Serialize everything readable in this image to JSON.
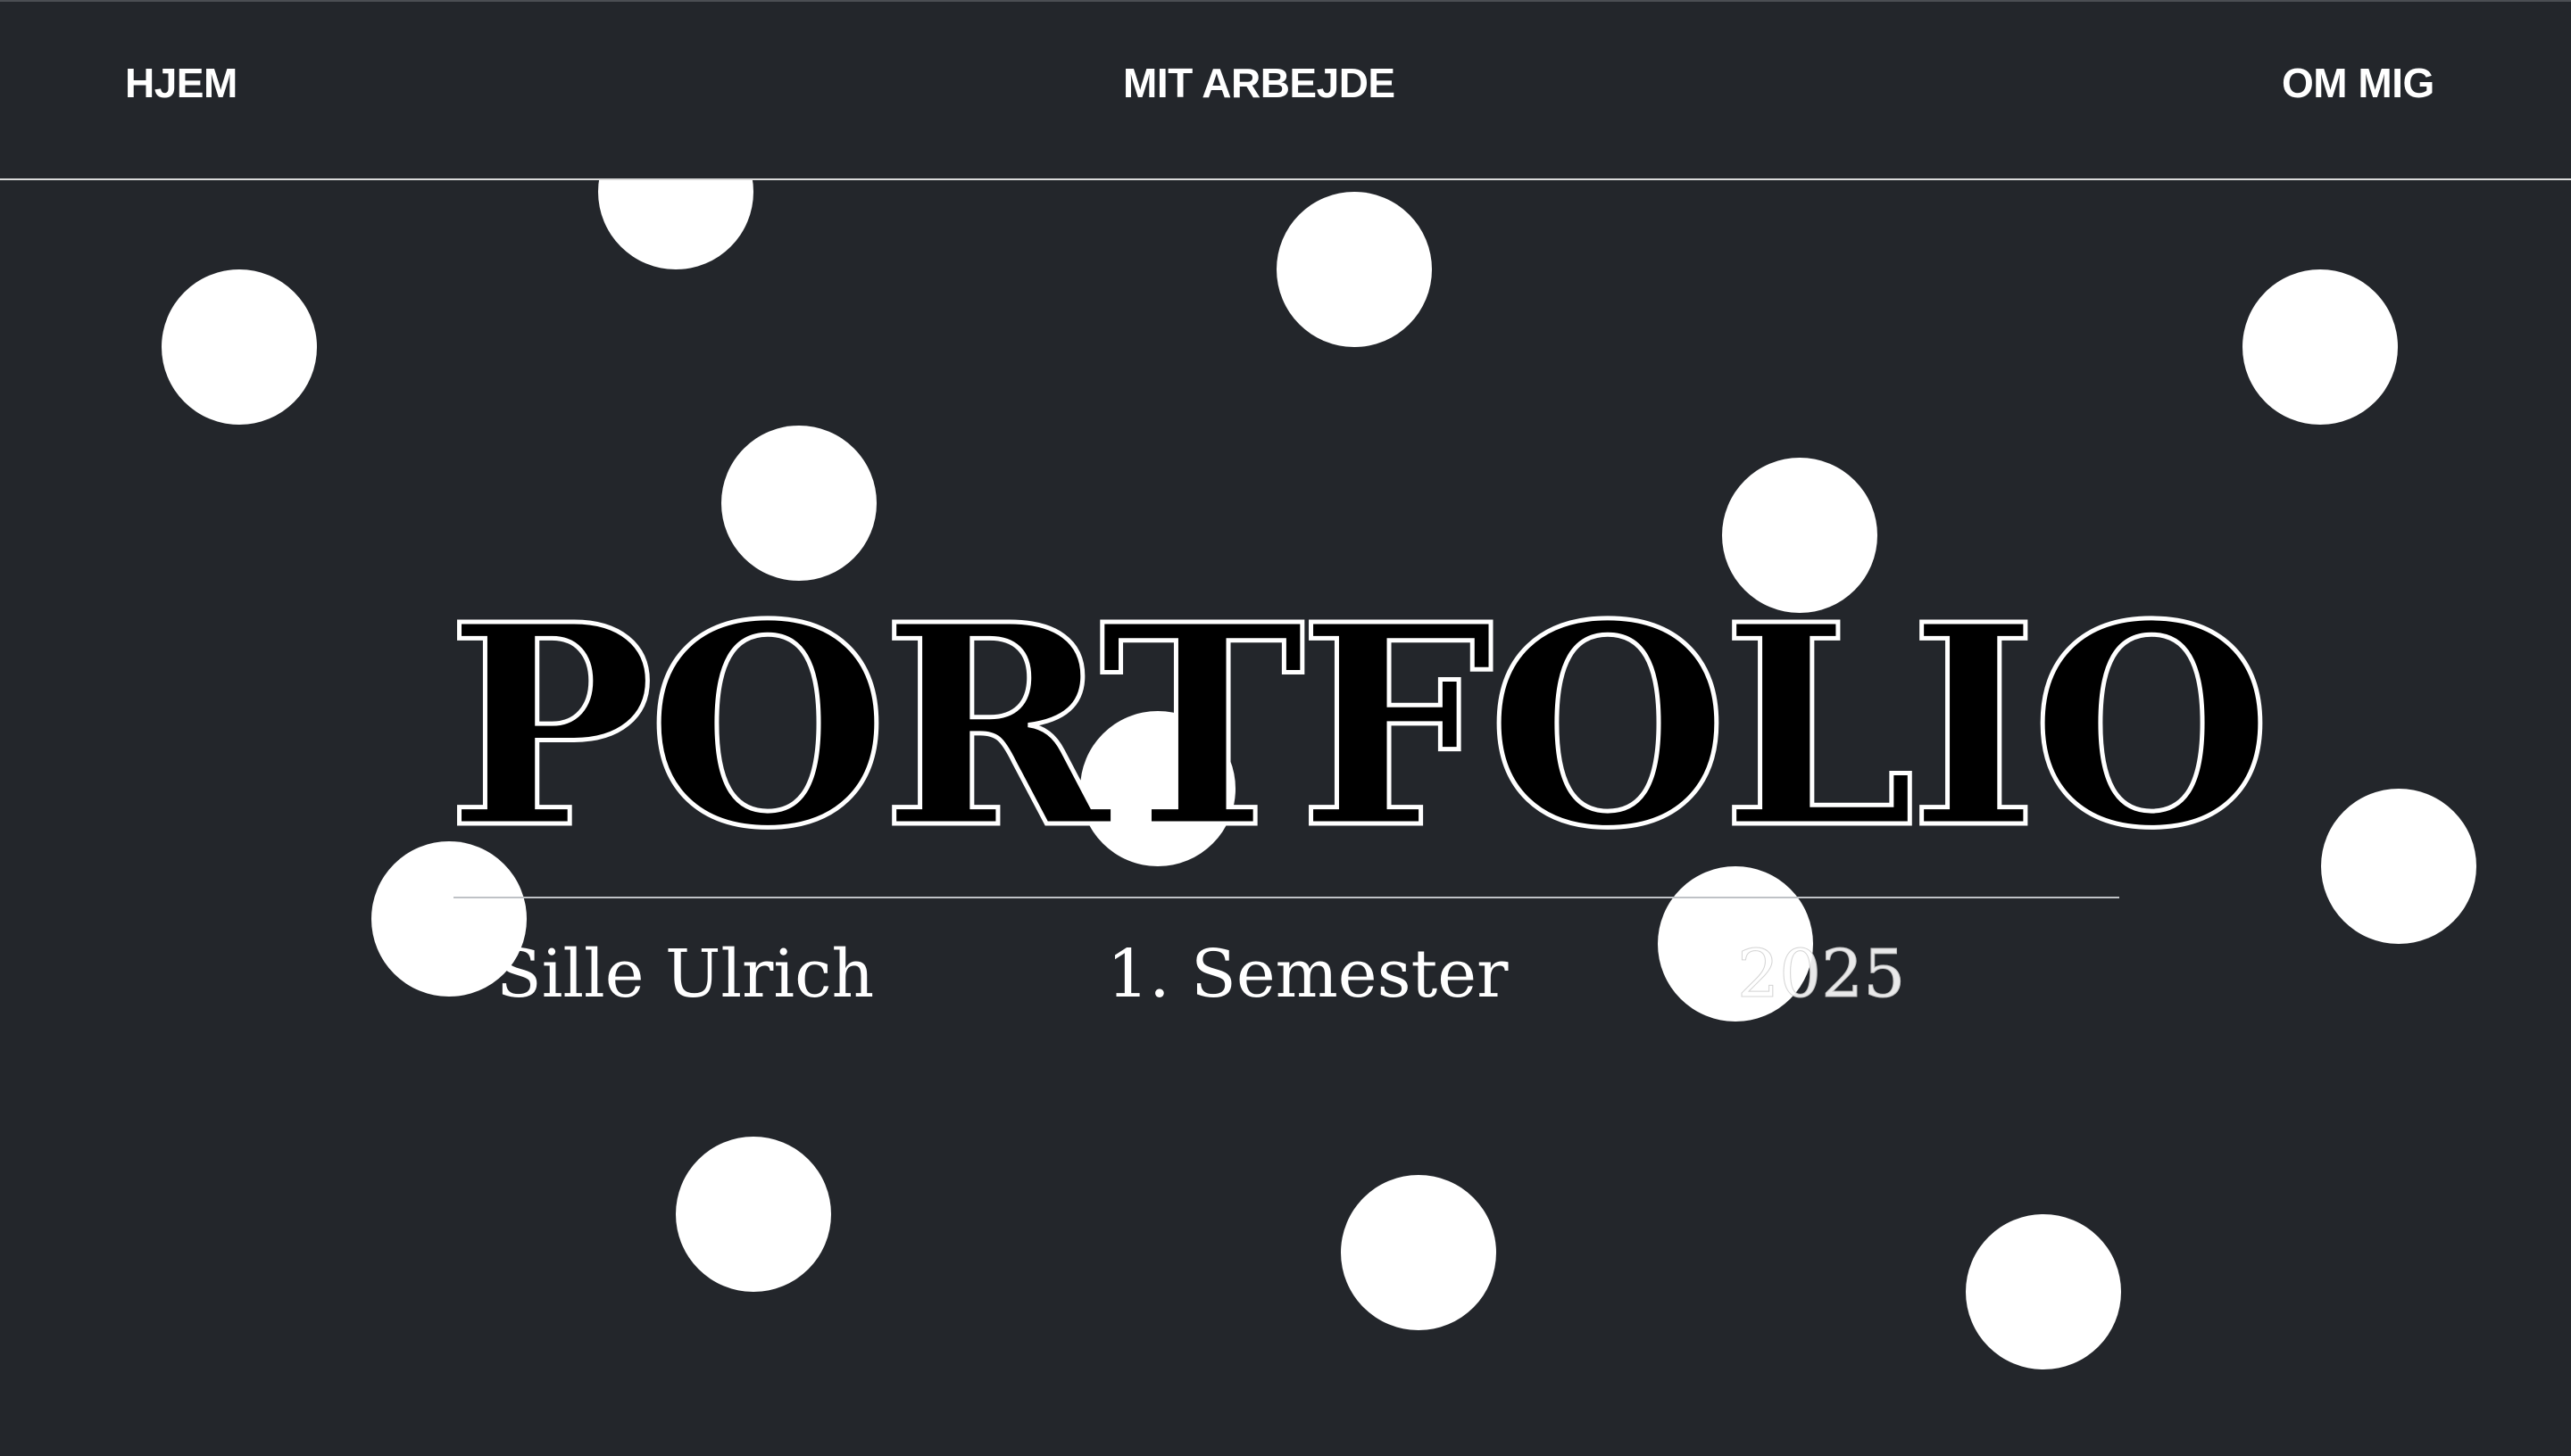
{
  "nav": {
    "home_label": "HJEM",
    "work_label": "MIT ARBEJDE",
    "about_label": "OM MIG"
  },
  "hero": {
    "title": "PORTFOLIO",
    "name": "Sille Ulrich",
    "semester": "1. Semester",
    "year": "2025"
  },
  "colors": {
    "background": "#23262b",
    "text": "#ffffff",
    "dots": "#ffffff",
    "title_fill": "#000000"
  }
}
